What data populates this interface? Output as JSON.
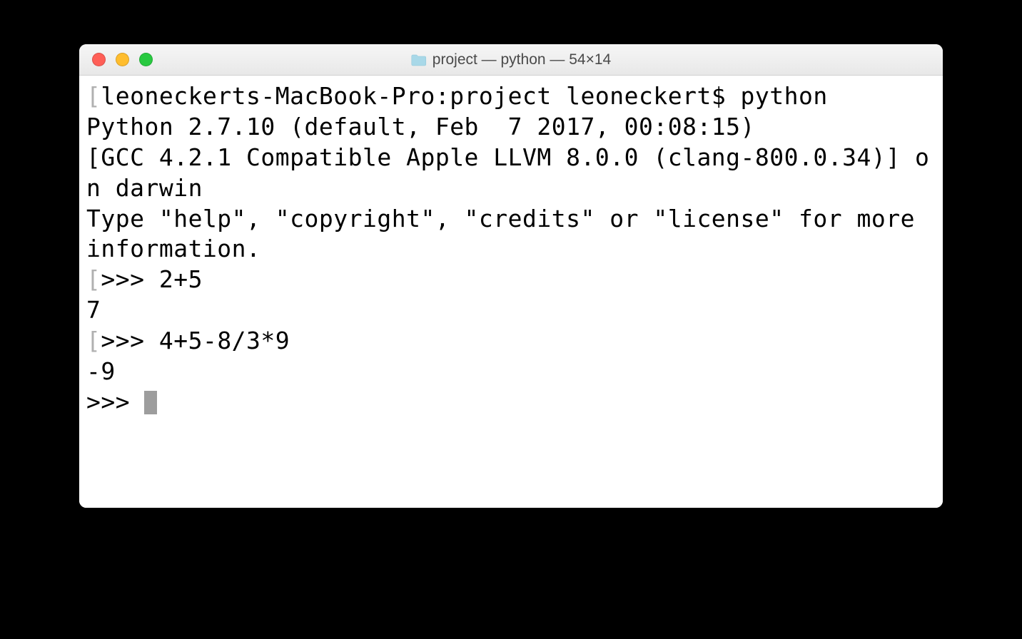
{
  "window": {
    "title": "project — python — 54×14",
    "traffic_lights": {
      "close": "close",
      "minimize": "minimize",
      "maximize": "maximize"
    }
  },
  "terminal": {
    "lines": [
      "leoneckerts-MacBook-Pro:project leoneckert$ python",
      "Python 2.7.10 (default, Feb  7 2017, 00:08:15) ",
      "[GCC 4.2.1 Compatible Apple LLVM 8.0.0 (clang-800.0.34)] on darwin",
      "Type \"help\", \"copyright\", \"credits\" or \"license\" for more information.",
      ">>> 2+5",
      "7",
      ">>> 4+5-8/3*9",
      "-9",
      ">>> "
    ],
    "prompt": ">>> "
  }
}
